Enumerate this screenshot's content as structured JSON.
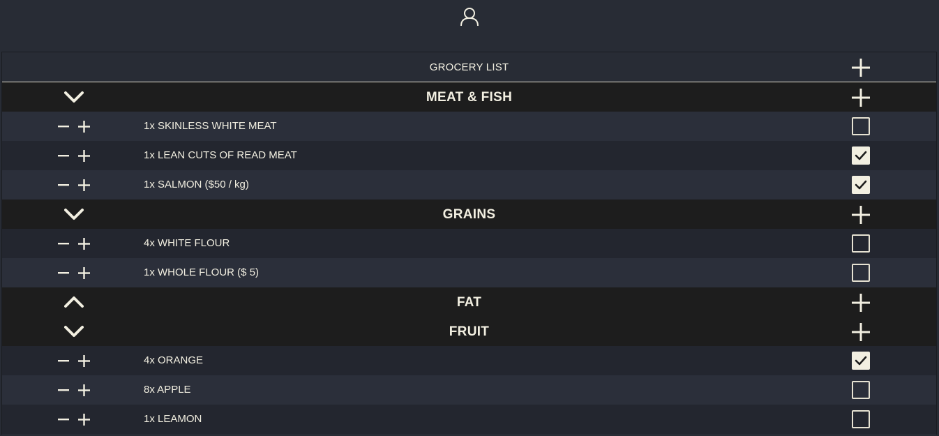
{
  "header": {
    "user_icon": "user-icon"
  },
  "list": {
    "title": "GROCERY LIST",
    "add_icon": "plus-icon"
  },
  "categories": [
    {
      "name": "MEAT & FISH",
      "expanded": true,
      "items": [
        {
          "label": "1x SKINLESS WHITE MEAT",
          "checked": false
        },
        {
          "label": "1x LEAN CUTS OF READ MEAT",
          "checked": true
        },
        {
          "label": "1x SALMON ($50 / kg)",
          "checked": true
        }
      ]
    },
    {
      "name": "GRAINS",
      "expanded": true,
      "items": [
        {
          "label": "4x WHITE FLOUR",
          "checked": false
        },
        {
          "label": "1x WHOLE FLOUR ($ 5)",
          "checked": false
        }
      ]
    },
    {
      "name": "FAT",
      "expanded": false,
      "items": []
    },
    {
      "name": "FRUIT",
      "expanded": true,
      "items": [
        {
          "label": "4x ORANGE",
          "checked": true
        },
        {
          "label": "8x APPLE",
          "checked": false
        },
        {
          "label": "1x LEAMON",
          "checked": false
        }
      ]
    }
  ],
  "colors": {
    "background": "#282c35",
    "category_bg": "#1d1d1d",
    "row_odd": "#2b2f3a",
    "row_even": "#23262f",
    "foreground": "#f2efe1"
  }
}
